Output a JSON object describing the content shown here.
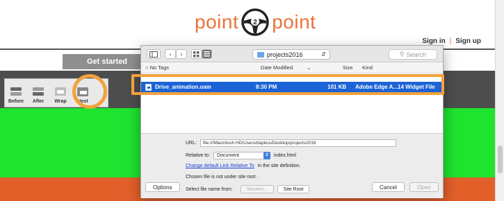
{
  "site": {
    "logo_left": "point",
    "logo_center": "2",
    "logo_right": "point",
    "sign_in": "Sign in",
    "separator": "|",
    "sign_up": "Sign up",
    "get_started": "Get started",
    "brand_color": "#e8733a",
    "toolbar": [
      {
        "label": "Before",
        "icon": "insert-before-icon"
      },
      {
        "label": "After",
        "icon": "insert-after-icon"
      },
      {
        "label": "Wrap",
        "icon": "wrap-icon"
      },
      {
        "label": "Nest",
        "icon": "nest-icon"
      }
    ]
  },
  "dialog": {
    "path": "projects2016",
    "search_placeholder": "Search",
    "columns": {
      "name": "No Tags",
      "date": "Date Modified",
      "size": "Size",
      "kind": "Kind"
    },
    "selected_file": {
      "name": "Drive_animation.oam",
      "date": "8:30 PM",
      "size": "101 KB",
      "kind": "Adobe Edge A...14 Widget File"
    },
    "url_label": "URL:",
    "url_value": "file:///Macintosh HD/Users/dapkus/Desktop/projects2016",
    "relative_label": "Relative to:",
    "relative_value": "Document",
    "relative_file": "index.html",
    "change_link": "Change default Link Relative To",
    "change_suffix": "in the site definition.",
    "chosen_note": "Chosen file is not under site root .",
    "select_from_label": "Select file name from:",
    "servers_button": "Servers...",
    "site_root_button": "Site Root",
    "options_button": "Options",
    "cancel_button": "Cancel",
    "open_button": "Open",
    "selection_color": "#1b63d6"
  },
  "highlight_color": "#f2a23d"
}
